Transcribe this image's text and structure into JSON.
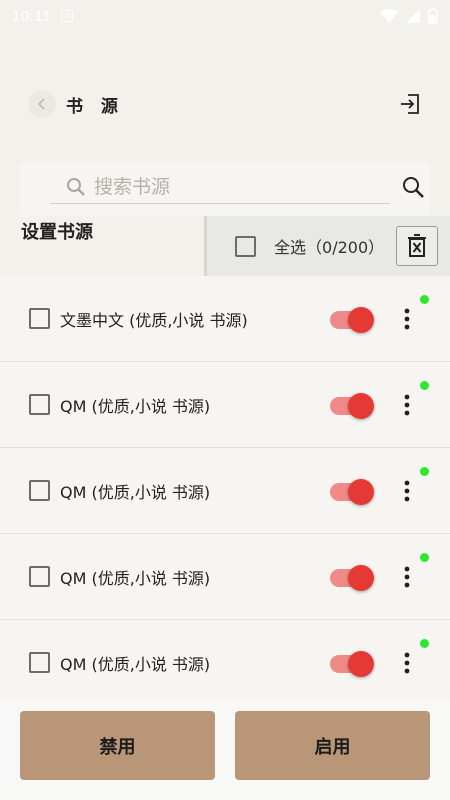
{
  "status_bar": {
    "time": "10:11",
    "notification_glyph": "A"
  },
  "header": {
    "title": "书 源",
    "back_icon": "back-arrow-icon",
    "import_icon": "import-icon"
  },
  "search": {
    "placeholder": "搜索书源",
    "value": ""
  },
  "section": {
    "label": "设置书源"
  },
  "selection": {
    "select_all_label": "全选",
    "count_text": "（0/200）"
  },
  "sources": [
    {
      "name": "文墨中文 (优质,小说 书源)",
      "enabled": true,
      "status": "online"
    },
    {
      "name": "QM (优质,小说 书源)",
      "enabled": true,
      "status": "online"
    },
    {
      "name": "QM (优质,小说 书源)",
      "enabled": true,
      "status": "online"
    },
    {
      "name": "QM (优质,小说 书源)",
      "enabled": true,
      "status": "online"
    },
    {
      "name": "QM (优质,小说 书源)",
      "enabled": true,
      "status": "online"
    }
  ],
  "actions": {
    "disable_label": "禁用",
    "enable_label": "启用"
  },
  "colors": {
    "accent_button": "#b89677",
    "toggle_thumb": "#e53935",
    "toggle_track": "#ef8a88",
    "status_online": "#2ee82e",
    "background": "#f2f1ec"
  }
}
